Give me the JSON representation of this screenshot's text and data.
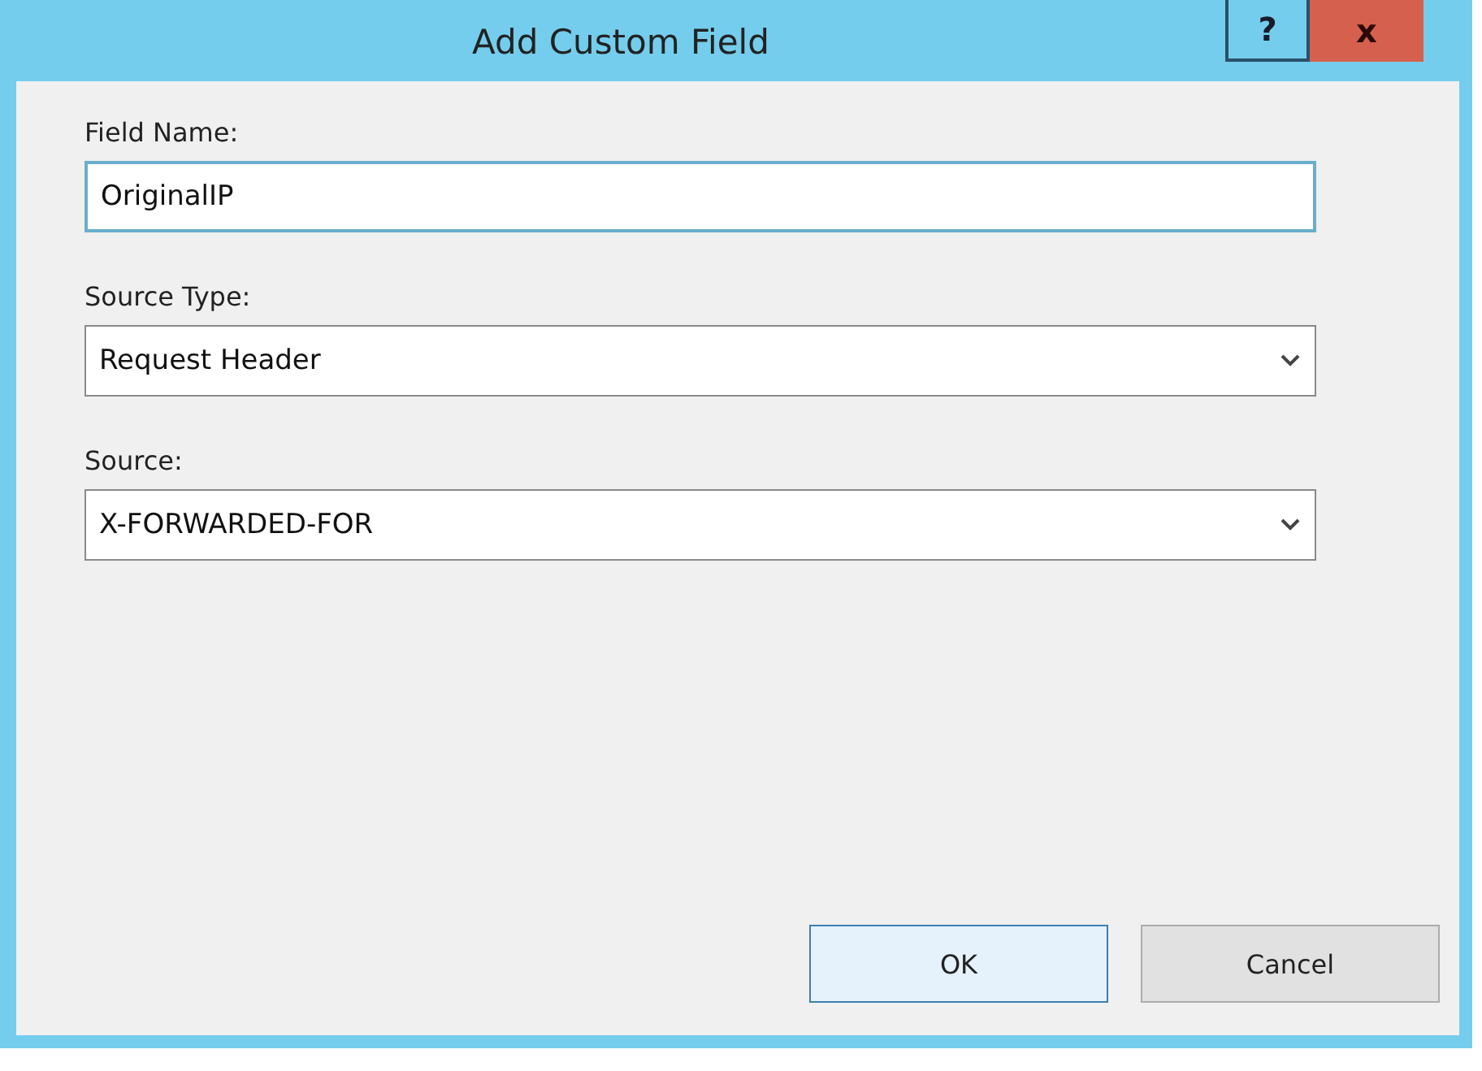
{
  "window": {
    "title": "Add Custom Field",
    "help_button": "?",
    "close_button": "x"
  },
  "fields": [
    {
      "kind": "text",
      "label": "Field Name:",
      "value": "OriginalIP"
    },
    {
      "kind": "combo",
      "label": "Source Type:",
      "value": "Request Header"
    },
    {
      "kind": "combo",
      "label": "Source:",
      "value": "X-FORWARDED-FOR"
    }
  ],
  "buttons": [
    "OK",
    "Cancel"
  ]
}
